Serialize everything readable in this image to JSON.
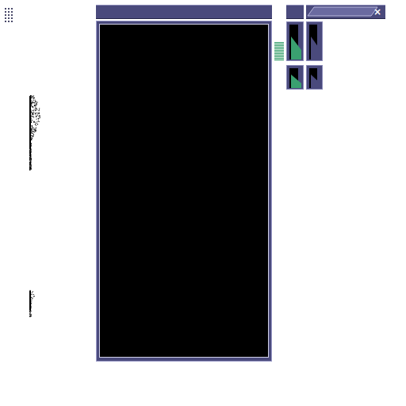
{
  "close_button": {
    "label": "×"
  }
}
